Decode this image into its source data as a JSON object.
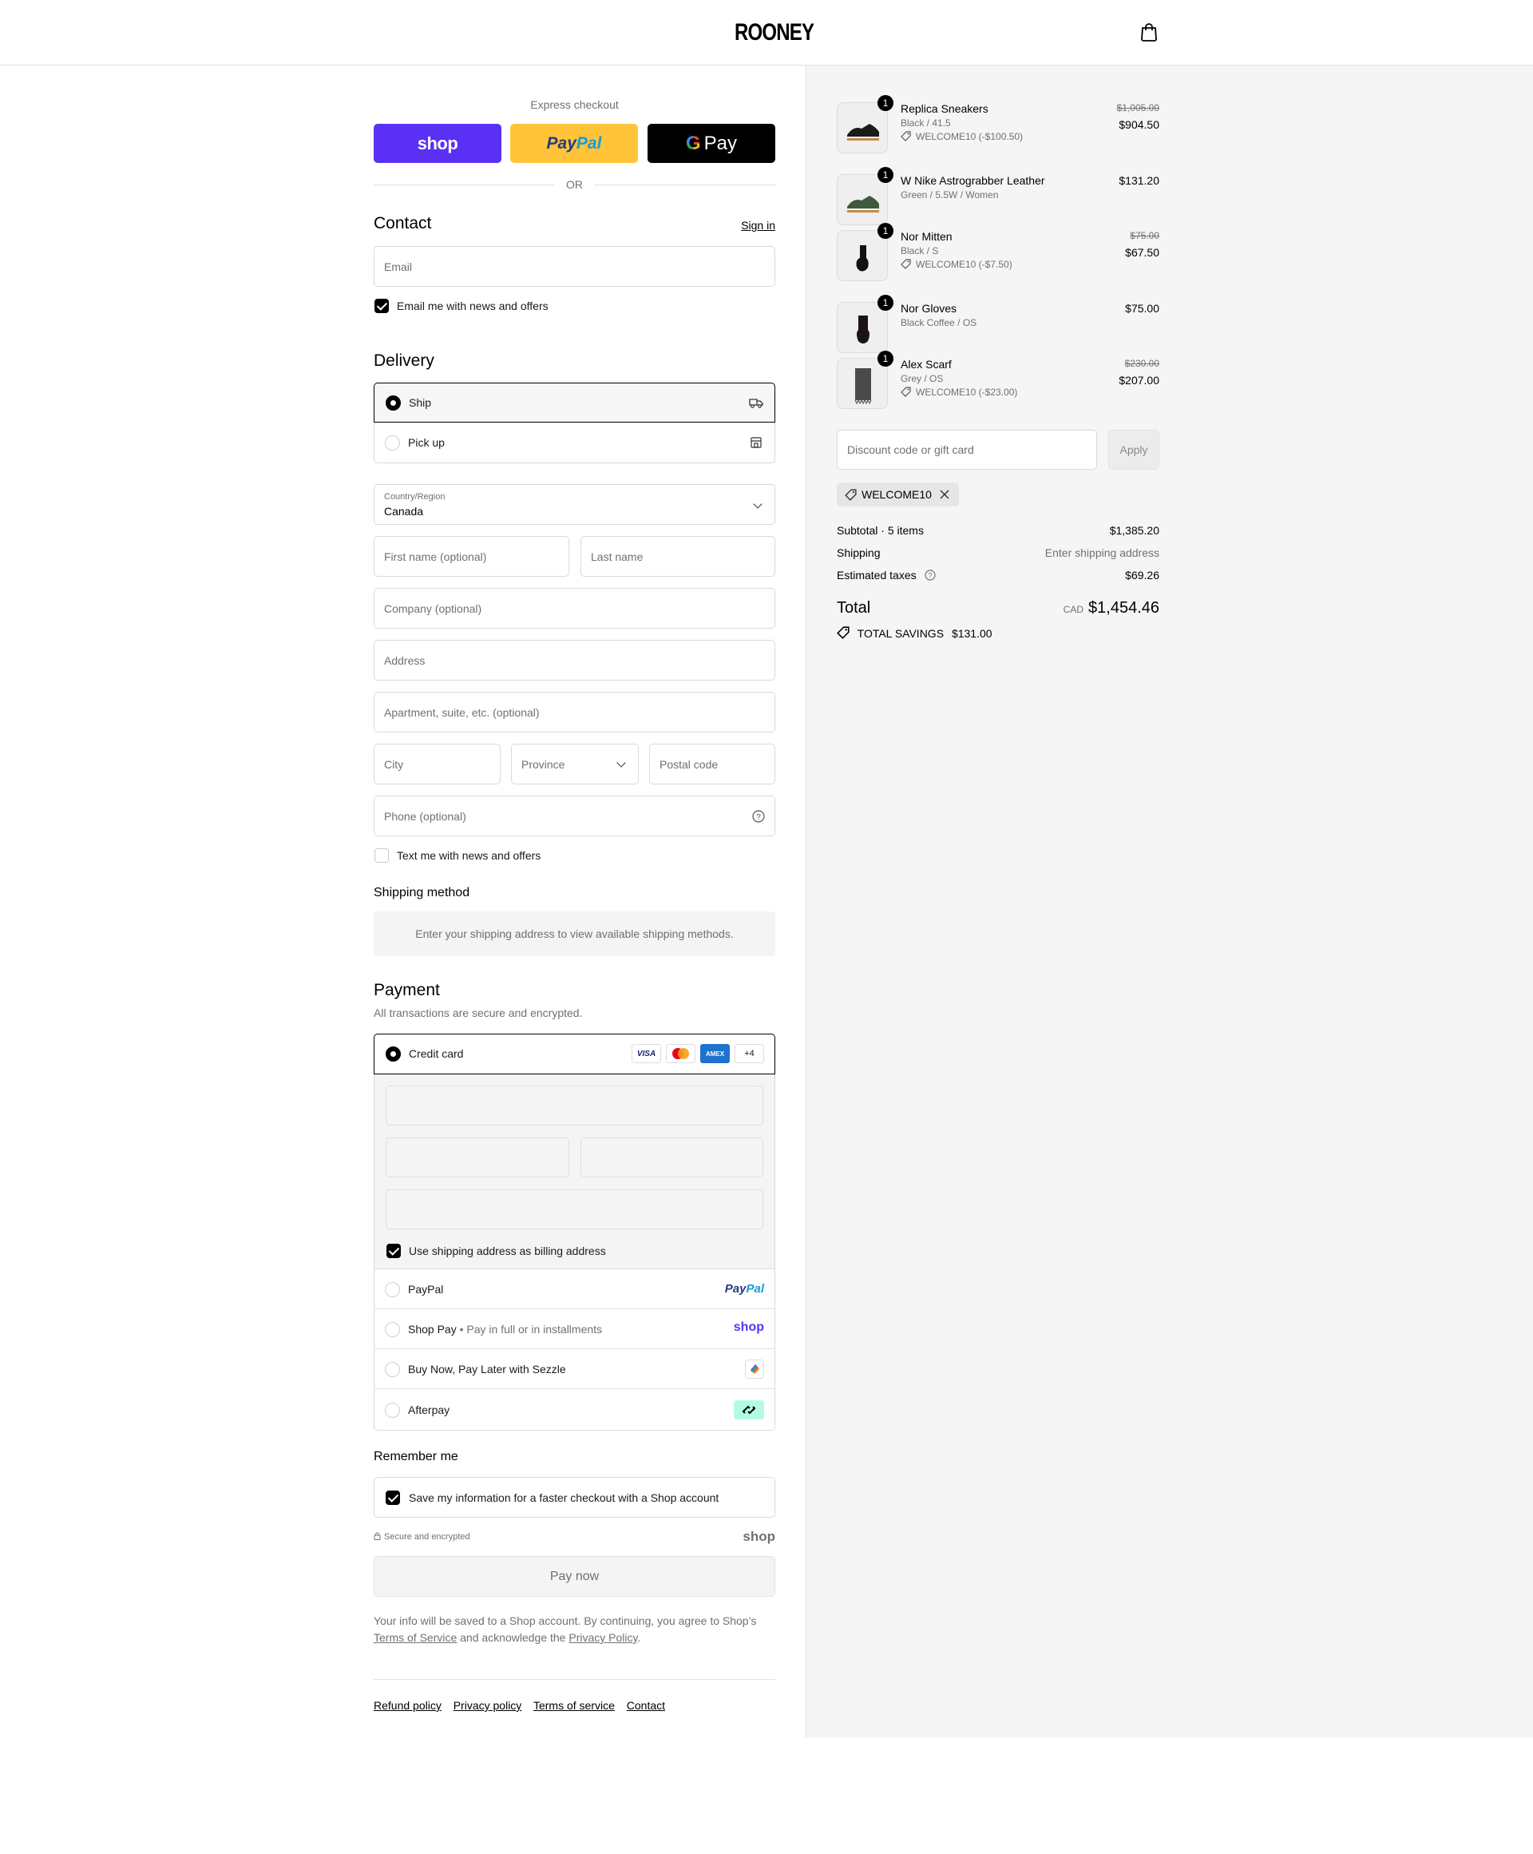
{
  "header": {
    "brand": "ROONEY"
  },
  "express": {
    "title": "Express checkout",
    "shop_label": "shop",
    "paypal_label_a": "Pay",
    "paypal_label_b": "Pal",
    "gpay_g": "G",
    "gpay_label": "Pay",
    "or": "OR"
  },
  "contact": {
    "title": "Contact",
    "sign_in": "Sign in",
    "email_placeholder": "Email",
    "news_label": "Email me with news and offers",
    "news_checked": true
  },
  "delivery": {
    "title": "Delivery",
    "options": [
      {
        "label": "Ship",
        "selected": true,
        "icon": "truck-icon"
      },
      {
        "label": "Pick up",
        "selected": false,
        "icon": "store-icon"
      }
    ],
    "country_label": "Country/Region",
    "country_value": "Canada",
    "first_name_placeholder": "First name (optional)",
    "last_name_placeholder": "Last name",
    "company_placeholder": "Company (optional)",
    "address_placeholder": "Address",
    "apartment_placeholder": "Apartment, suite, etc. (optional)",
    "city_placeholder": "City",
    "province_placeholder": "Province",
    "postal_placeholder": "Postal code",
    "phone_placeholder": "Phone (optional)",
    "sms_label": "Text me with news and offers",
    "sms_checked": false
  },
  "shipping_method": {
    "title": "Shipping method",
    "notice": "Enter your shipping address to view available shipping methods."
  },
  "payment": {
    "title": "Payment",
    "subtitle": "All transactions are secure and encrypted.",
    "credit_card_label": "Credit card",
    "card_brands": [
      "VISA",
      "mastercard",
      "AMEX"
    ],
    "more_brands": "+4",
    "billing_label": "Use shipping address as billing address",
    "billing_checked": true,
    "methods": [
      {
        "label": "PayPal",
        "logo_a": "Pay",
        "logo_b": "Pal"
      },
      {
        "label": "Shop Pay",
        "sub": "Pay in full or in installments",
        "logo": "shop"
      },
      {
        "label": "Buy Now, Pay Later with Sezzle",
        "logo": "sezzle-icon"
      },
      {
        "label": "Afterpay",
        "logo": "afterpay-icon"
      }
    ]
  },
  "remember": {
    "title": "Remember me",
    "save_label": "Save my information for a faster checkout with a Shop account",
    "save_checked": true,
    "secure": "Secure and encrypted",
    "shop_logo": "shop"
  },
  "pay_now": "Pay now",
  "legal": {
    "line_a": "Your info will be saved to a Shop account. By continuing, you agree to Shop’s",
    "terms": "Terms of Service",
    "mid": "and acknowledge the",
    "privacy": "Privacy Policy",
    "end": "."
  },
  "footer_links": [
    "Refund policy",
    "Privacy policy",
    "Terms of service",
    "Contact"
  ],
  "order": {
    "items": [
      {
        "name": "Replica Sneakers",
        "variant": "Black / 41.5",
        "discount": "WELCOME10 (-$100.50)",
        "old_price": "$1,005.00",
        "price": "$904.50",
        "qty": "1"
      },
      {
        "name": "W Nike Astrograbber Leather",
        "variant": "Green / 5.5W / Women",
        "discount": "",
        "old_price": "",
        "price": "$131.20",
        "qty": "1"
      },
      {
        "name": "Nor Mitten",
        "variant": "Black / S",
        "discount": "WELCOME10 (-$7.50)",
        "old_price": "$75.00",
        "price": "$67.50",
        "qty": "1"
      },
      {
        "name": "Nor Gloves",
        "variant": "Black Coffee / OS",
        "discount": "",
        "old_price": "",
        "price": "$75.00",
        "qty": "1"
      },
      {
        "name": "Alex Scarf",
        "variant": "Grey / OS",
        "discount": "WELCOME10 (-$23.00)",
        "old_price": "$230.00",
        "price": "$207.00",
        "qty": "1"
      }
    ],
    "discount_placeholder": "Discount code or gift card",
    "apply": "Apply",
    "applied_code": "WELCOME10",
    "subtotal_label": "Subtotal · 5 items",
    "subtotal": "$1,385.20",
    "shipping_label": "Shipping",
    "shipping_value": "Enter shipping address",
    "taxes_label": "Estimated taxes",
    "taxes": "$69.26",
    "total_label": "Total",
    "currency": "CAD",
    "total": "$1,454.46",
    "savings_label": "TOTAL SAVINGS",
    "savings": "$131.00"
  },
  "colors": {
    "shop_purple": "#5a31f4",
    "paypal_yellow": "#ffc439",
    "sidebar_bg": "#f5f5f5"
  }
}
